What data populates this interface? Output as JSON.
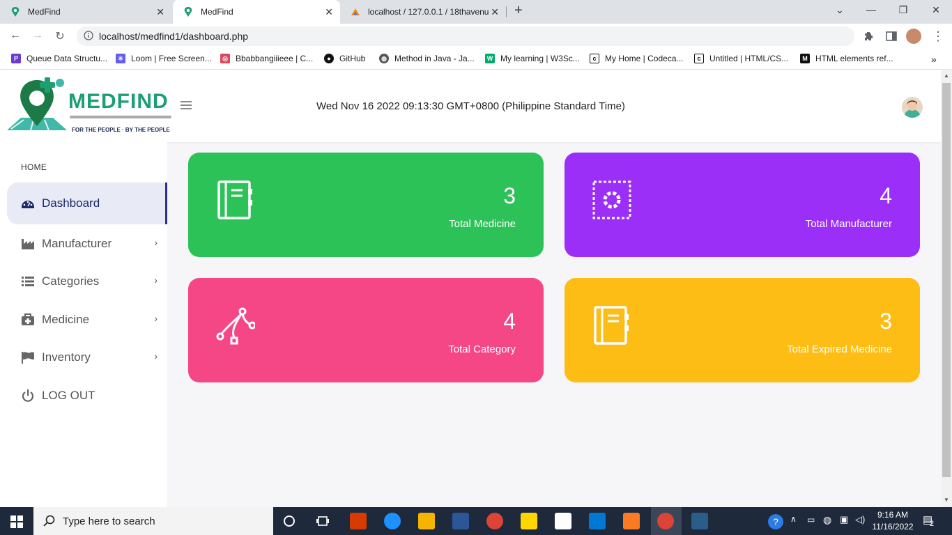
{
  "browser": {
    "tabs": [
      {
        "title": "MedFind",
        "active": false
      },
      {
        "title": "MedFind",
        "active": true
      },
      {
        "title": "localhost / 127.0.0.1 / 18thavenu",
        "active": false
      }
    ],
    "url": "localhost/medfind1/dashboard.php",
    "bookmarks": [
      "Queue Data Structu...",
      "Loom | Free Screen...",
      "Bbabbangiiieee | C...",
      "GitHub",
      "Method in Java - Ja...",
      "My learning | W3Sc...",
      "My Home | Codeca...",
      "Untitled | HTML/CS...",
      "HTML elements ref..."
    ]
  },
  "header": {
    "logo_text": "MEDFIND",
    "logo_tagline": "FOR THE PEOPLE · BY THE PEOPLE",
    "datetime": "Wed Nov 16 2022 09:13:30 GMT+0800 (Philippine Standard Time)"
  },
  "sidebar": {
    "section_label": "HOME",
    "items": [
      {
        "label": "Dashboard",
        "icon": "dashboard-icon",
        "active": true
      },
      {
        "label": "Manufacturer",
        "icon": "factory-icon"
      },
      {
        "label": "Categories",
        "icon": "list-icon"
      },
      {
        "label": "Medicine",
        "icon": "medkit-icon"
      },
      {
        "label": "Inventory",
        "icon": "flag-icon"
      },
      {
        "label": "LOG OUT",
        "icon": "power-icon"
      }
    ]
  },
  "cards": [
    {
      "value": "3",
      "label": "Total Medicine",
      "color": "#2dc258",
      "icon": "notebook-icon"
    },
    {
      "value": "4",
      "label": "Total Manufacturer",
      "color": "#9b2ef7",
      "icon": "gear-icon"
    },
    {
      "value": "4",
      "label": "Total Category",
      "color": "#f54685",
      "icon": "vector-icon"
    },
    {
      "value": "3",
      "label": "Total Expired Medicine",
      "color": "#fdbd15",
      "icon": "notebook-icon"
    }
  ],
  "taskbar": {
    "search_placeholder": "Type here to search",
    "time": "9:16 AM",
    "date": "11/16/2022",
    "notification_count": "2"
  }
}
